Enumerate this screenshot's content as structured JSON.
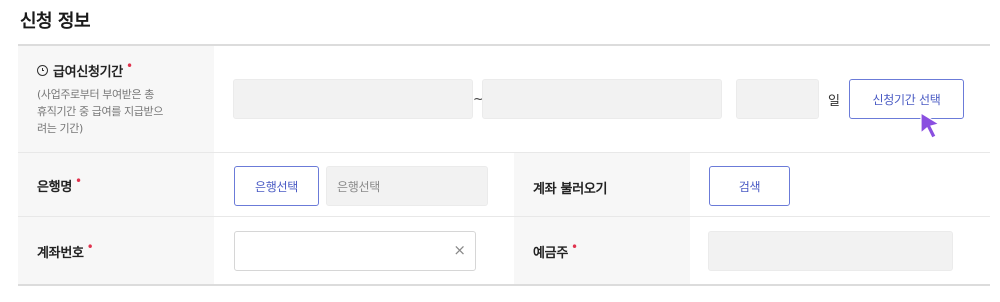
{
  "section_title": "신청 정보",
  "colors": {
    "accent": "#4a5bc4",
    "required": "#e0334e"
  },
  "period": {
    "label": "급여신청기간",
    "icon": "info-circle-icon",
    "desc_lines": [
      "(사업주로부터 부여받은 총",
      "휴직기간 중 급여를 지급받으",
      "려는 기간)"
    ],
    "separator": "~",
    "day_unit": "일",
    "select_button": "신청기간 선택"
  },
  "bank": {
    "label": "은행명",
    "select_button": "은행선택",
    "value_placeholder": "은행선택"
  },
  "account_fetch": {
    "label": "계좌 불러오기",
    "search_button": "검색"
  },
  "account_number": {
    "label": "계좌번호",
    "value": "",
    "clear_icon": "×"
  },
  "depositor": {
    "label": "예금주",
    "value": ""
  },
  "required_mark": "•"
}
